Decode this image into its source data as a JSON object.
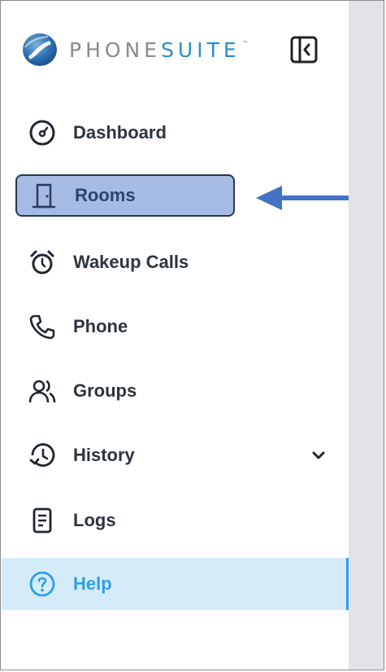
{
  "app": {
    "logo_phone": "PHONE",
    "logo_suite": "SUITE",
    "logo_tm": "™"
  },
  "sidebar": {
    "items": [
      {
        "label": "Dashboard",
        "icon": "dashboard-gauge-icon"
      },
      {
        "label": "Rooms",
        "icon": "door-icon",
        "selected": true
      },
      {
        "label": "Wakeup Calls",
        "icon": "alarm-clock-icon"
      },
      {
        "label": "Phone",
        "icon": "phone-icon"
      },
      {
        "label": "Groups",
        "icon": "users-icon"
      },
      {
        "label": "History",
        "icon": "history-icon",
        "has_dropdown": true
      },
      {
        "label": "Logs",
        "icon": "document-icon"
      },
      {
        "label": "Help",
        "icon": "help-circle-icon",
        "active": true
      }
    ]
  },
  "colors": {
    "brand_gray": "#8a8a8a",
    "brand_blue": "#2a8dc9",
    "selected_bg": "#a6bbe4",
    "help_bg": "#d4ecf9",
    "help_accent": "#2f9ee6",
    "annotation_arrow": "#4472c4"
  }
}
